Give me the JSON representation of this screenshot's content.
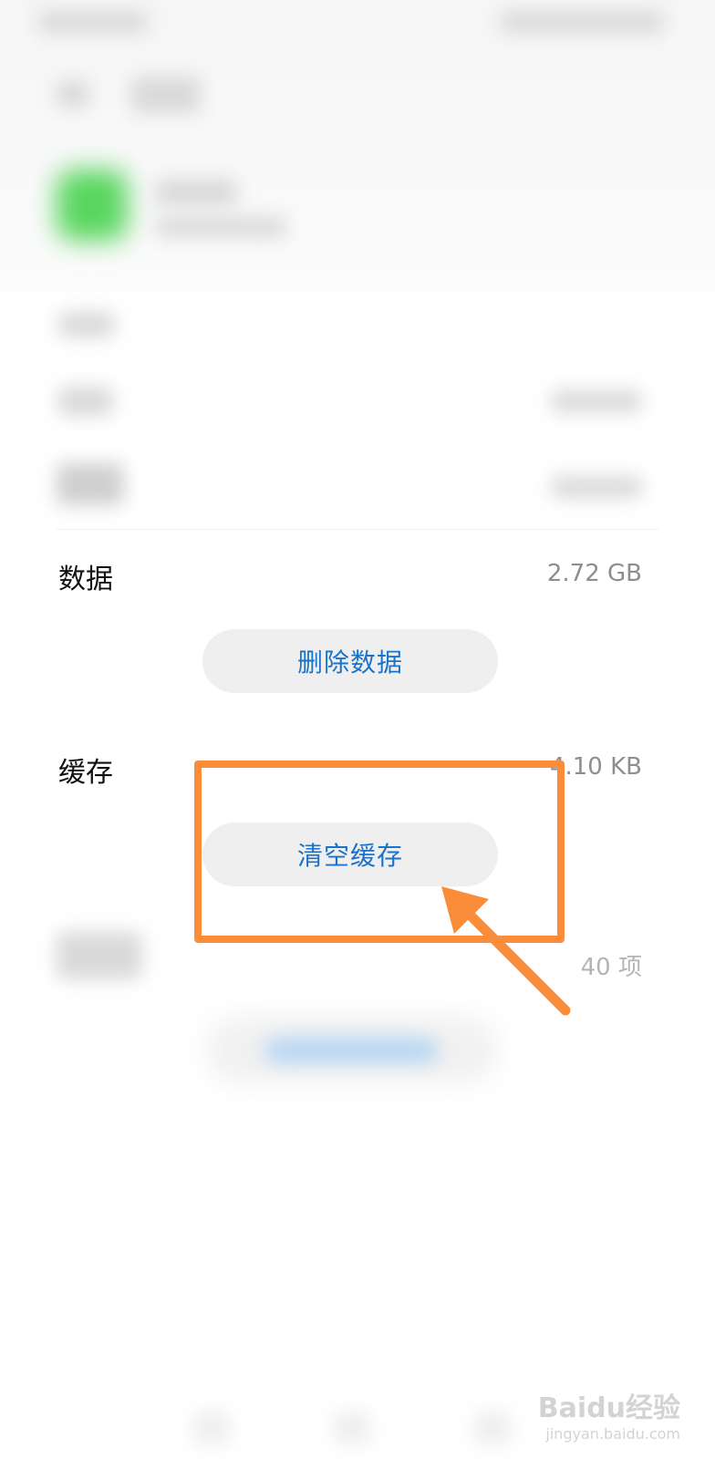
{
  "storage": {
    "data_label": "数据",
    "data_value": "2.72 GB",
    "delete_data_button": "删除数据",
    "cache_label": "缓存",
    "cache_value": "4.10 KB",
    "clear_cache_button": "清空缓存",
    "defaults_value": "40 项"
  },
  "watermark": {
    "text": "Baidu经验",
    "url": "jingyan.baidu.com"
  },
  "colors": {
    "accent_text": "#1a73c8",
    "highlight": "#fb8d3a",
    "app_icon": "#59d65e"
  }
}
